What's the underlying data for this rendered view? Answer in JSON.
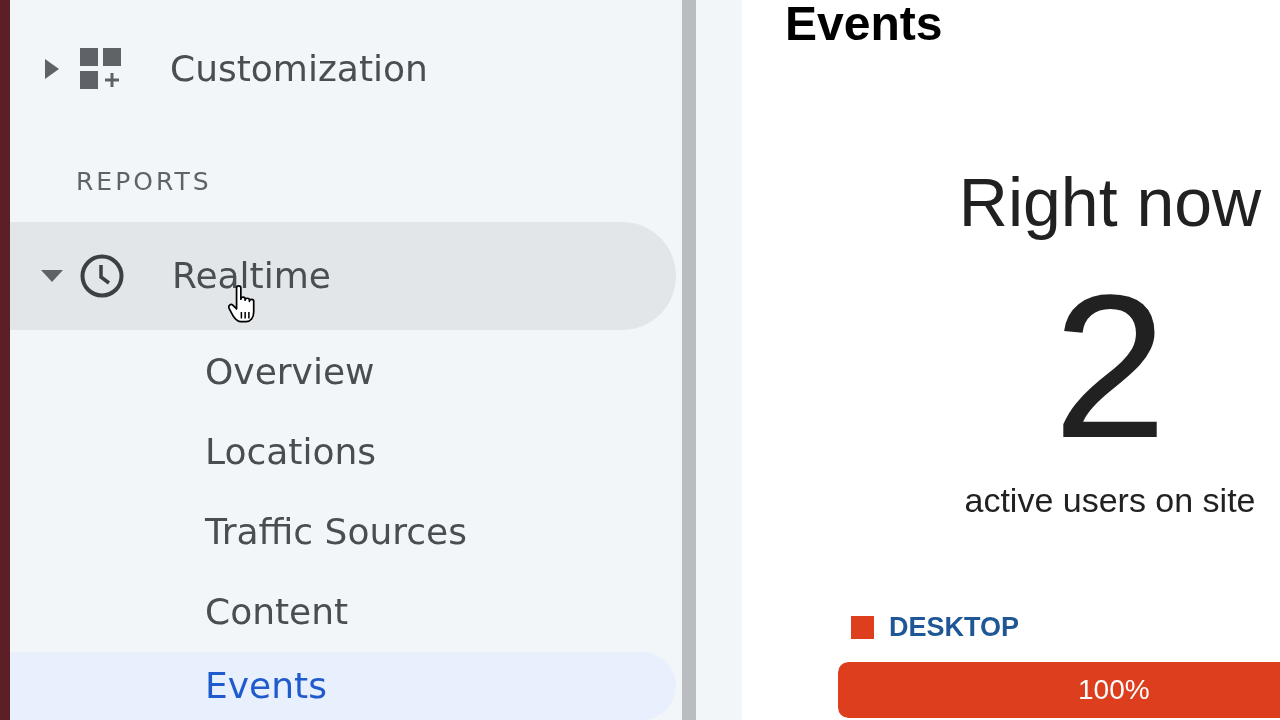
{
  "sidebar": {
    "items": [
      {
        "label": "Customization",
        "expanded": false,
        "hovered": false,
        "selected": false
      }
    ],
    "section": {
      "title": "REPORTS",
      "items": [
        {
          "label": "Realtime",
          "expanded": true,
          "hovered": true,
          "selected": false,
          "children": [
            {
              "label": "Overview",
              "selected": false
            },
            {
              "label": "Locations",
              "selected": false
            },
            {
              "label": "Traffic Sources",
              "selected": false
            },
            {
              "label": "Content",
              "selected": false
            },
            {
              "label": "Events",
              "selected": true
            }
          ]
        }
      ]
    }
  },
  "main": {
    "title": "Events",
    "realtime": {
      "heading": "Right now",
      "count": "2",
      "caption": "active users on site",
      "devices": [
        {
          "label": "DESKTOP",
          "color": "#dc3e1e",
          "level": 1,
          "reading": "100%"
        }
      ]
    }
  }
}
